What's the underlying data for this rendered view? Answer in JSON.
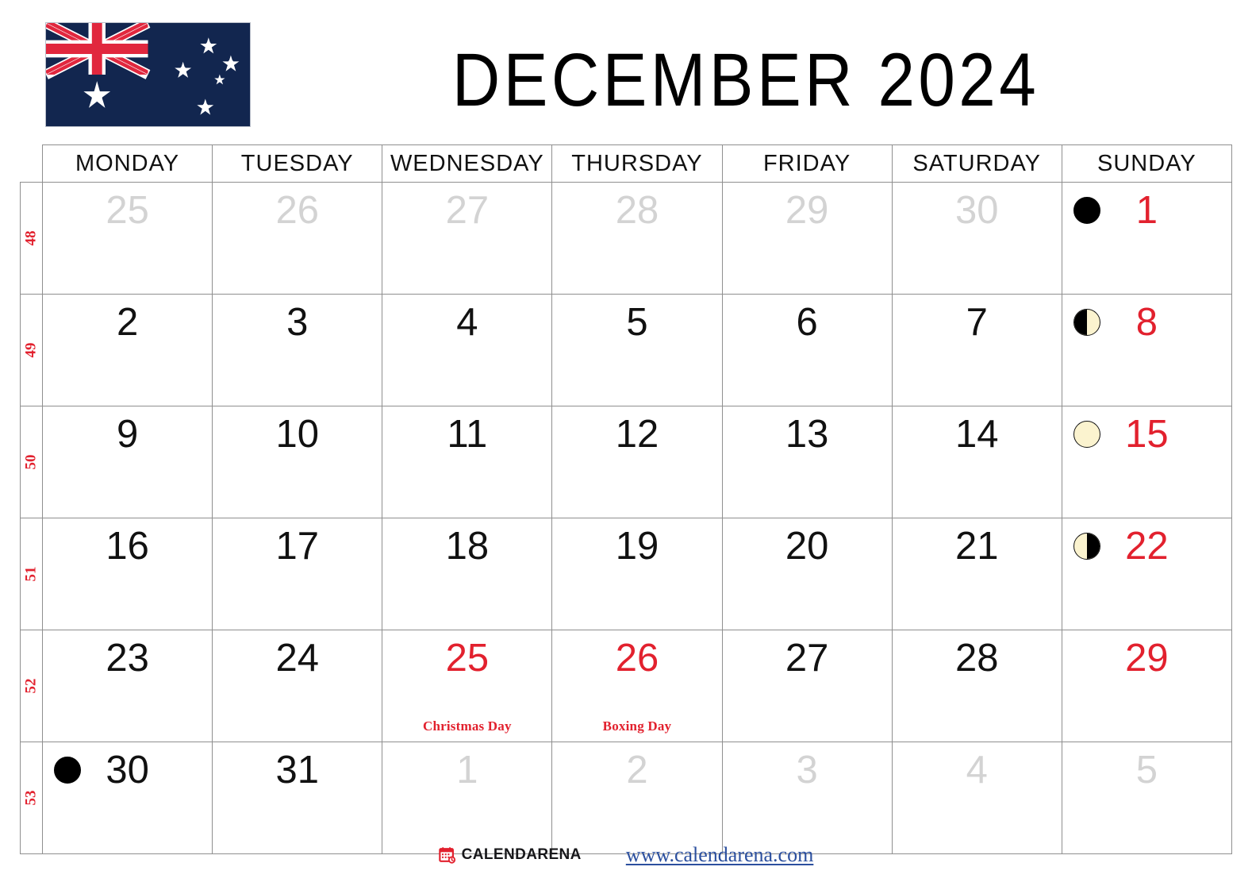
{
  "header": {
    "title": "DECEMBER 2024",
    "flag_name": "australia-flag",
    "flag_colors": {
      "navy": "#12264F",
      "red": "#E1273E",
      "white": "#FFFFFF"
    }
  },
  "weekday_headers": [
    "MONDAY",
    "TUESDAY",
    "WEDNESDAY",
    "THURSDAY",
    "FRIDAY",
    "SATURDAY",
    "SUNDAY"
  ],
  "week_number_header": "",
  "colors": {
    "red": "#e2212e",
    "muted": "#d3d3d3",
    "grid": "#8f8f8f",
    "link": "#2b4f9e",
    "moon_light": "#fbf3cf"
  },
  "weeks": [
    {
      "week_number": "48",
      "days": [
        {
          "num": "25",
          "type": "out",
          "moon": "",
          "holiday": ""
        },
        {
          "num": "26",
          "type": "out",
          "moon": "",
          "holiday": ""
        },
        {
          "num": "27",
          "type": "out",
          "moon": "",
          "holiday": ""
        },
        {
          "num": "28",
          "type": "out",
          "moon": "",
          "holiday": ""
        },
        {
          "num": "29",
          "type": "out",
          "moon": "",
          "holiday": ""
        },
        {
          "num": "30",
          "type": "out",
          "moon": "",
          "holiday": ""
        },
        {
          "num": "1",
          "type": "weekend",
          "moon": "new",
          "holiday": ""
        }
      ]
    },
    {
      "week_number": "49",
      "days": [
        {
          "num": "2",
          "type": "normal",
          "moon": "",
          "holiday": ""
        },
        {
          "num": "3",
          "type": "normal",
          "moon": "",
          "holiday": ""
        },
        {
          "num": "4",
          "type": "normal",
          "moon": "",
          "holiday": ""
        },
        {
          "num": "5",
          "type": "normal",
          "moon": "",
          "holiday": ""
        },
        {
          "num": "6",
          "type": "normal",
          "moon": "",
          "holiday": ""
        },
        {
          "num": "7",
          "type": "normal",
          "moon": "",
          "holiday": ""
        },
        {
          "num": "8",
          "type": "weekend",
          "moon": "first",
          "holiday": ""
        }
      ]
    },
    {
      "week_number": "50",
      "days": [
        {
          "num": "9",
          "type": "normal",
          "moon": "",
          "holiday": ""
        },
        {
          "num": "10",
          "type": "normal",
          "moon": "",
          "holiday": ""
        },
        {
          "num": "11",
          "type": "normal",
          "moon": "",
          "holiday": ""
        },
        {
          "num": "12",
          "type": "normal",
          "moon": "",
          "holiday": ""
        },
        {
          "num": "13",
          "type": "normal",
          "moon": "",
          "holiday": ""
        },
        {
          "num": "14",
          "type": "normal",
          "moon": "",
          "holiday": ""
        },
        {
          "num": "15",
          "type": "weekend",
          "moon": "full",
          "holiday": ""
        }
      ]
    },
    {
      "week_number": "51",
      "days": [
        {
          "num": "16",
          "type": "normal",
          "moon": "",
          "holiday": ""
        },
        {
          "num": "17",
          "type": "normal",
          "moon": "",
          "holiday": ""
        },
        {
          "num": "18",
          "type": "normal",
          "moon": "",
          "holiday": ""
        },
        {
          "num": "19",
          "type": "normal",
          "moon": "",
          "holiday": ""
        },
        {
          "num": "20",
          "type": "normal",
          "moon": "",
          "holiday": ""
        },
        {
          "num": "21",
          "type": "normal",
          "moon": "",
          "holiday": ""
        },
        {
          "num": "22",
          "type": "weekend",
          "moon": "last",
          "holiday": ""
        }
      ]
    },
    {
      "week_number": "52",
      "days": [
        {
          "num": "23",
          "type": "normal",
          "moon": "",
          "holiday": ""
        },
        {
          "num": "24",
          "type": "normal",
          "moon": "",
          "holiday": ""
        },
        {
          "num": "25",
          "type": "holiday",
          "moon": "",
          "holiday": "Christmas Day"
        },
        {
          "num": "26",
          "type": "holiday",
          "moon": "",
          "holiday": "Boxing Day"
        },
        {
          "num": "27",
          "type": "normal",
          "moon": "",
          "holiday": ""
        },
        {
          "num": "28",
          "type": "normal",
          "moon": "",
          "holiday": ""
        },
        {
          "num": "29",
          "type": "weekend",
          "moon": "",
          "holiday": ""
        }
      ]
    },
    {
      "week_number": "53",
      "days": [
        {
          "num": "30",
          "type": "normal",
          "moon": "new",
          "holiday": ""
        },
        {
          "num": "31",
          "type": "normal",
          "moon": "",
          "holiday": ""
        },
        {
          "num": "1",
          "type": "out",
          "moon": "",
          "holiday": ""
        },
        {
          "num": "2",
          "type": "out",
          "moon": "",
          "holiday": ""
        },
        {
          "num": "3",
          "type": "out",
          "moon": "",
          "holiday": ""
        },
        {
          "num": "4",
          "type": "out",
          "moon": "",
          "holiday": ""
        },
        {
          "num": "5",
          "type": "out",
          "moon": "",
          "holiday": ""
        }
      ]
    }
  ],
  "footer": {
    "icon_name": "calendar-icon",
    "brand": "CALENDARENA",
    "url": "www.calendarena.com"
  }
}
